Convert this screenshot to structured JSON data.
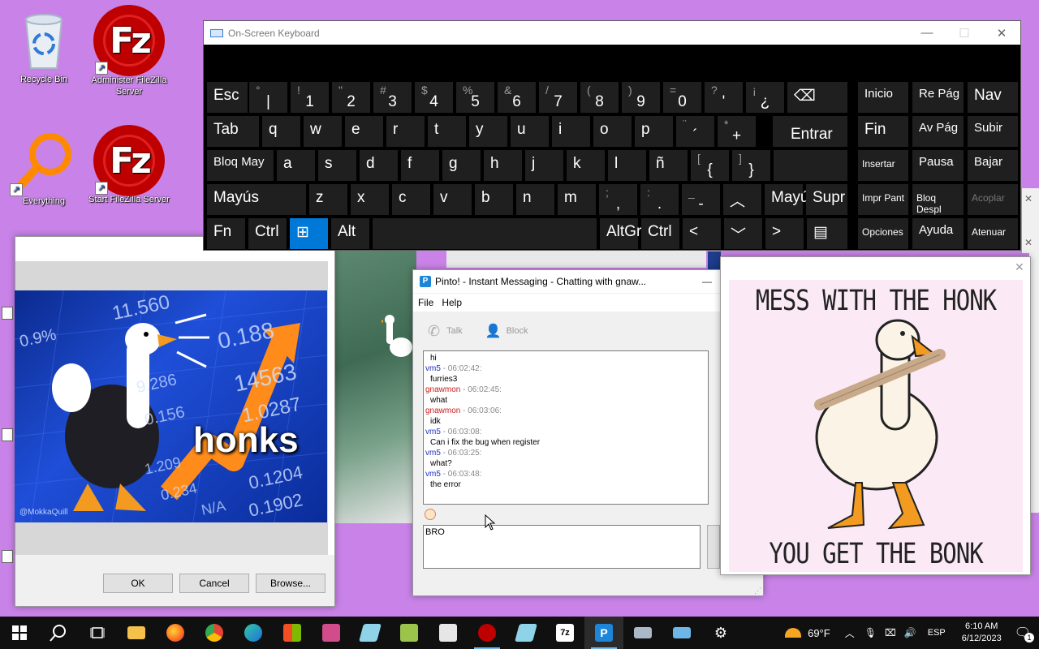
{
  "desktop": {
    "icons": [
      {
        "label": "Recycle Bin",
        "icon": "recycle-bin-icon"
      },
      {
        "label": "Administer FileZilla Server",
        "icon": "filezilla-icon"
      },
      {
        "label": "Everything",
        "icon": "everything-search-icon"
      },
      {
        "label": "Start FileZilla Server",
        "icon": "filezilla-icon"
      }
    ]
  },
  "osk": {
    "title": "On-Screen Keyboard",
    "rows": [
      [
        {
          "m": "Esc"
        },
        {
          "s": "°",
          "l": "|"
        },
        {
          "s": "!",
          "l": "1"
        },
        {
          "s": "\"",
          "l": "2"
        },
        {
          "s": "#",
          "l": "3"
        },
        {
          "s": "$",
          "l": "4"
        },
        {
          "s": "%",
          "l": "5"
        },
        {
          "s": "&",
          "l": "6"
        },
        {
          "s": "/",
          "l": "7"
        },
        {
          "s": "(",
          "l": "8"
        },
        {
          "s": ")",
          "l": "9"
        },
        {
          "s": "=",
          "l": "0"
        },
        {
          "s": "?",
          "l": "'"
        },
        {
          "s": "¡",
          "l": "¿"
        },
        {
          "m": "⌫"
        }
      ],
      [
        {
          "m": "Tab"
        },
        {
          "m": "q"
        },
        {
          "m": "w"
        },
        {
          "m": "e"
        },
        {
          "m": "r"
        },
        {
          "m": "t"
        },
        {
          "m": "y"
        },
        {
          "m": "u"
        },
        {
          "m": "i"
        },
        {
          "m": "o"
        },
        {
          "m": "p"
        },
        {
          "s": "¨",
          "l": "´"
        },
        {
          "s": "*",
          "l": "+"
        },
        {
          "m": "Entrar"
        }
      ],
      [
        {
          "m": "Bloq May"
        },
        {
          "m": "a"
        },
        {
          "m": "s"
        },
        {
          "m": "d"
        },
        {
          "m": "f"
        },
        {
          "m": "g"
        },
        {
          "m": "h"
        },
        {
          "m": "j"
        },
        {
          "m": "k"
        },
        {
          "m": "l"
        },
        {
          "m": "ñ"
        },
        {
          "s": "[",
          "l": "{"
        },
        {
          "s": "]",
          "l": "}"
        }
      ],
      [
        {
          "m": "Mayús"
        },
        {
          "m": "z"
        },
        {
          "m": "x"
        },
        {
          "m": "c"
        },
        {
          "m": "v"
        },
        {
          "m": "b"
        },
        {
          "m": "n"
        },
        {
          "m": "m"
        },
        {
          "s": ";",
          "l": ","
        },
        {
          "s": ":",
          "l": "."
        },
        {
          "s": "_",
          "l": "-"
        },
        {
          "m": "︿"
        },
        {
          "m": "Mayús"
        },
        {
          "m": "Supr"
        }
      ],
      [
        {
          "m": "Fn"
        },
        {
          "m": "Ctrl"
        },
        {
          "m": "⊞"
        },
        {
          "m": "Alt"
        },
        {
          "m": ""
        },
        {
          "m": "AltGr"
        },
        {
          "m": "Ctrl"
        },
        {
          "m": "<"
        },
        {
          "m": "﹀"
        },
        {
          "m": ">"
        },
        {
          "m": "▤"
        }
      ]
    ],
    "nav": [
      [
        "Inicio",
        "Re Pág",
        "Nav"
      ],
      [
        "Fin",
        "Av Pág",
        "Subir"
      ],
      [
        "Insertar",
        "Pausa",
        "Bajar"
      ],
      [
        "Impr Pant",
        "Bloq Despl",
        "Acoplar"
      ],
      [
        "Opciones",
        "Ayuda",
        "Atenuar"
      ]
    ]
  },
  "dialog": {
    "ok": "OK",
    "cancel": "Cancel",
    "browse": "Browse..."
  },
  "meme": {
    "text": "honks",
    "watermark": "@MokkaQuill",
    "numbers": [
      "11.560",
      "0.9%",
      "0.188",
      "14563",
      "9.286",
      "1.0287",
      "0.156",
      "0.1204",
      "1.209",
      "0.1902",
      "0.234",
      "N/A"
    ]
  },
  "pinto": {
    "title": "Pinto! - Instant Messaging - Chatting with gnaw...",
    "menu": [
      "File",
      "Help"
    ],
    "toolbar": {
      "talk": "Talk",
      "block": "Block"
    },
    "messages": [
      {
        "type": "text",
        "text": "hi"
      },
      {
        "type": "head",
        "user": "vm5",
        "time": " - 06:02:42:",
        "color": "#1f2fc2"
      },
      {
        "type": "text",
        "text": "furries3"
      },
      {
        "type": "head",
        "user": "gnawmon",
        "time": " - 06:02:45:",
        "color": "#c81e1e"
      },
      {
        "type": "text",
        "text": "what"
      },
      {
        "type": "head",
        "user": "gnawmon",
        "time": " - 06:03:06:",
        "color": "#c81e1e"
      },
      {
        "type": "text",
        "text": "idk"
      },
      {
        "type": "head",
        "user": "vm5",
        "time": " - 06:03:08:",
        "color": "#1f2fc2"
      },
      {
        "type": "text",
        "text": "Can i fix the bug when register"
      },
      {
        "type": "head",
        "user": "vm5",
        "time": " - 06:03:25:",
        "color": "#1f2fc2"
      },
      {
        "type": "text",
        "text": "what?"
      },
      {
        "type": "head",
        "user": "vm5",
        "time": " - 06:03:48:",
        "color": "#1f2fc2"
      },
      {
        "type": "text",
        "text": "the error"
      }
    ],
    "input": "BRO"
  },
  "poster": {
    "top": "MESS WITH THE HONK",
    "bottom": "YOU GET THE BONK"
  },
  "taskbar": {
    "weather": "69°F",
    "lang": "ESP",
    "time": "6:10 AM",
    "date": "6/12/2023"
  }
}
